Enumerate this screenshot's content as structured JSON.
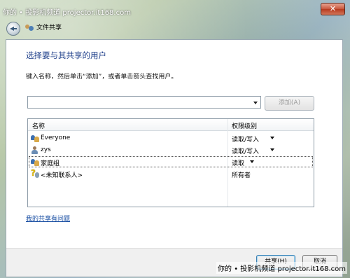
{
  "watermark": {
    "top": "你的 • 投影机频道 projector.it168.com",
    "bottom": "你的 • 投影机频道 projector.it168.com"
  },
  "window": {
    "close_label": "✕",
    "title": "文件共享"
  },
  "main": {
    "heading": "选择要与其共享的用户",
    "instruction": "键入名称，然后单击“添加”，或者单击箭头查找用户。",
    "name_input_value": "",
    "add_button": "添加(A)",
    "list": {
      "col_name": "名称",
      "col_permission": "权限级别",
      "rows": [
        {
          "name": "Everyone",
          "permission": "读取/写入",
          "icon": "group-icon"
        },
        {
          "name": "zys",
          "permission": "读取/写入",
          "icon": "user-icon"
        },
        {
          "name": "家庭组",
          "permission": "读取",
          "icon": "group-icon"
        },
        {
          "name": "<未知联系人>",
          "permission": "所有者",
          "icon": "unknown-contact-icon"
        }
      ]
    },
    "help_link": "我的共享有问题"
  },
  "footer": {
    "share_button": "共享(H)",
    "cancel_button": "取消"
  }
}
